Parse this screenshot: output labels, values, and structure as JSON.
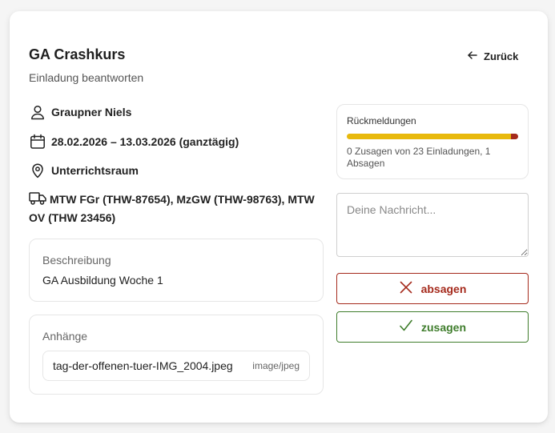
{
  "header": {
    "title": "GA Crashkurs",
    "subtitle": "Einladung beantworten",
    "back_label": "Zurück"
  },
  "details": {
    "person": "Graupner Niels",
    "date": "28.02.2026 – 13.03.2026 (ganztägig)",
    "location": "Unterrichtsraum",
    "vehicles": "MTW FGr (THW-87654), MzGW (THW-98763), MTW OV (THW 23456)"
  },
  "description": {
    "label": "Beschreibung",
    "text": "GA Ausbildung Woche 1"
  },
  "attachments": {
    "label": "Anhänge",
    "items": [
      {
        "name": "tag-der-offenen-tuer-IMG_2004.jpeg",
        "type": "image/jpeg"
      }
    ]
  },
  "responses": {
    "label": "Rückmeldungen",
    "summary": "0 Zusagen von 23 Einladungen, 1 Absagen",
    "accepted": 0,
    "declined": 1,
    "invited": 23
  },
  "message": {
    "placeholder": "Deine Nachricht...",
    "value": ""
  },
  "actions": {
    "decline_label": "absagen",
    "accept_label": "zusagen"
  },
  "colors": {
    "decline": "#a52a1c",
    "accept": "#3f7d2c",
    "pending": "#e8b90d"
  }
}
